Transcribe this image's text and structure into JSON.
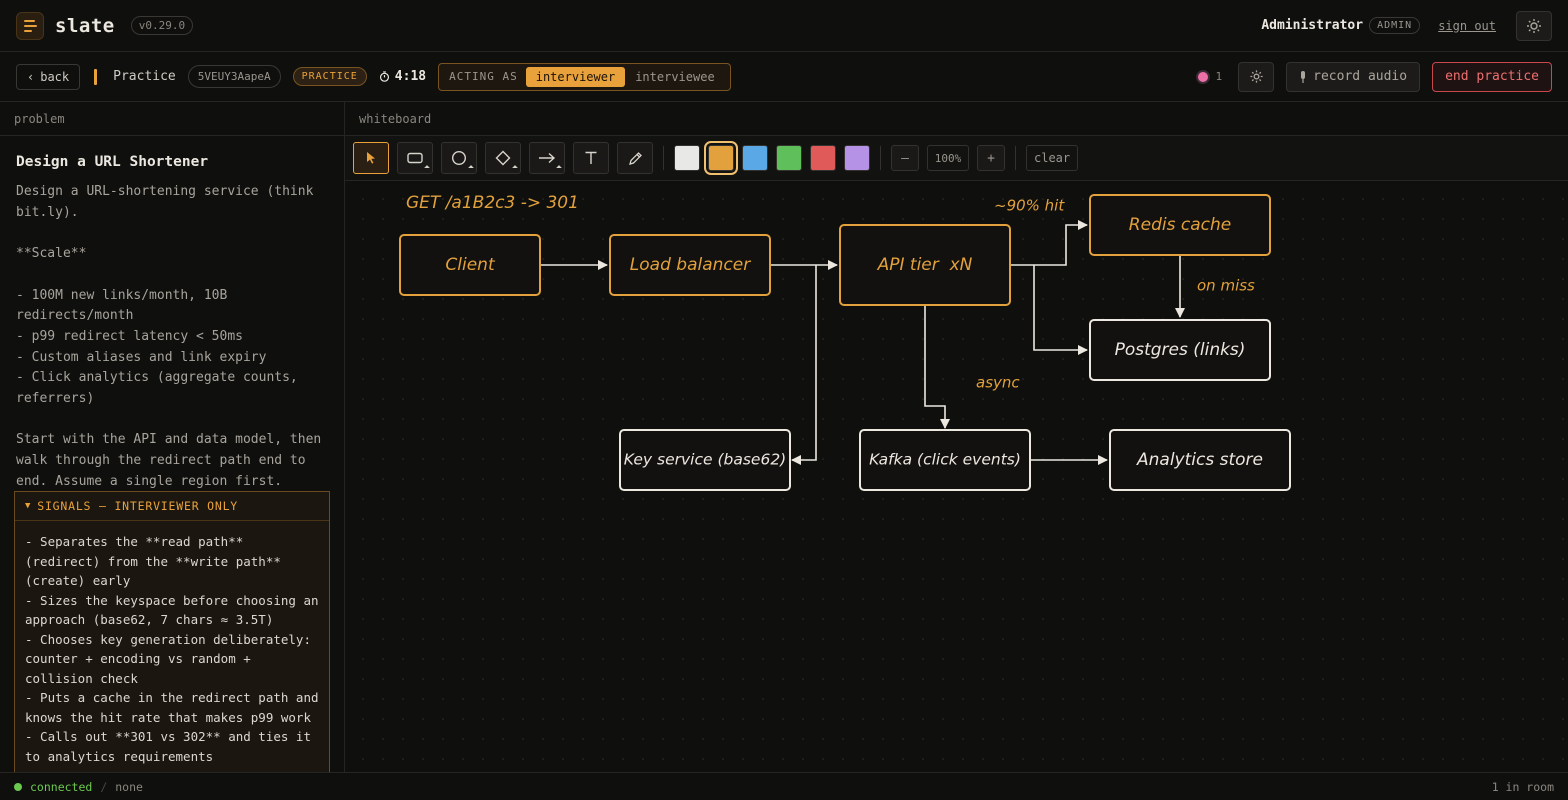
{
  "app": {
    "name": "slate",
    "version": "v0.29.0"
  },
  "user": {
    "name": "Administrator",
    "role": "ADMIN",
    "signout_label": "sign out"
  },
  "session": {
    "back_label": "back",
    "title": "Practice",
    "code": "5VEUY3AapeA",
    "mode_badge": "PRACTICE",
    "timer": "4:18",
    "acting_label": "ACTING AS",
    "roles": [
      "interviewer",
      "interviewee"
    ],
    "active_role": "interviewer",
    "presence_count": "1",
    "record_label": "record audio",
    "end_label": "end practice"
  },
  "problem": {
    "header": "problem",
    "title": "Design a URL Shortener",
    "body": "Design a URL-shortening service (think bit.ly).\n\n**Scale**\n\n- 100M new links/month, 10B redirects/month\n- p99 redirect latency < 50ms\n- Custom aliases and link expiry\n- Click analytics (aggregate counts, referrers)\n\nStart with the API and data model, then walk through the redirect path end to end. Assume a single region first.",
    "signals_header": "SIGNALS — INTERVIEWER ONLY",
    "signals_body": "- Separates the **read path** (redirect) from the **write path** (create) early\n- Sizes the keyspace before choosing an approach (base62, 7 chars ≈ 3.5T)\n- Chooses key generation deliberately: counter + encoding vs random + collision check\n- Puts a cache in the redirect path and knows the hit rate that makes p99 work\n- Calls out **301 vs 302** and ties it to analytics requirements"
  },
  "whiteboard": {
    "header": "whiteboard",
    "tools": [
      "select-tool",
      "rectangle-tool",
      "ellipse-tool",
      "diamond-tool",
      "arrow-tool",
      "text-tool",
      "pen-tool"
    ],
    "active_tool": "select-tool",
    "colors": [
      "#e8e8e6",
      "#e2a13c",
      "#5aa8e6",
      "#5fbf5a",
      "#e05a5a",
      "#b592e6"
    ],
    "active_color": "#e2a13c",
    "zoom": "100%",
    "zoom_out_label": "–",
    "zoom_in_label": "+",
    "clear_label": "clear",
    "diagram": {
      "annotation_top": "GET /a1B2c3 -> 301",
      "label_hit": "~90% hit",
      "label_miss": "on miss",
      "label_async": "async",
      "nodes": {
        "client": "Client",
        "lb": "Load balancer",
        "api": "API tier  xN",
        "redis": "Redis cache",
        "postgres": "Postgres (links)",
        "keysvc": "Key service (base62)",
        "kafka": "Kafka (click events)",
        "analytics": "Analytics store"
      }
    }
  },
  "status": {
    "connection": "connected",
    "peer": "none",
    "room": "1 in room"
  }
}
